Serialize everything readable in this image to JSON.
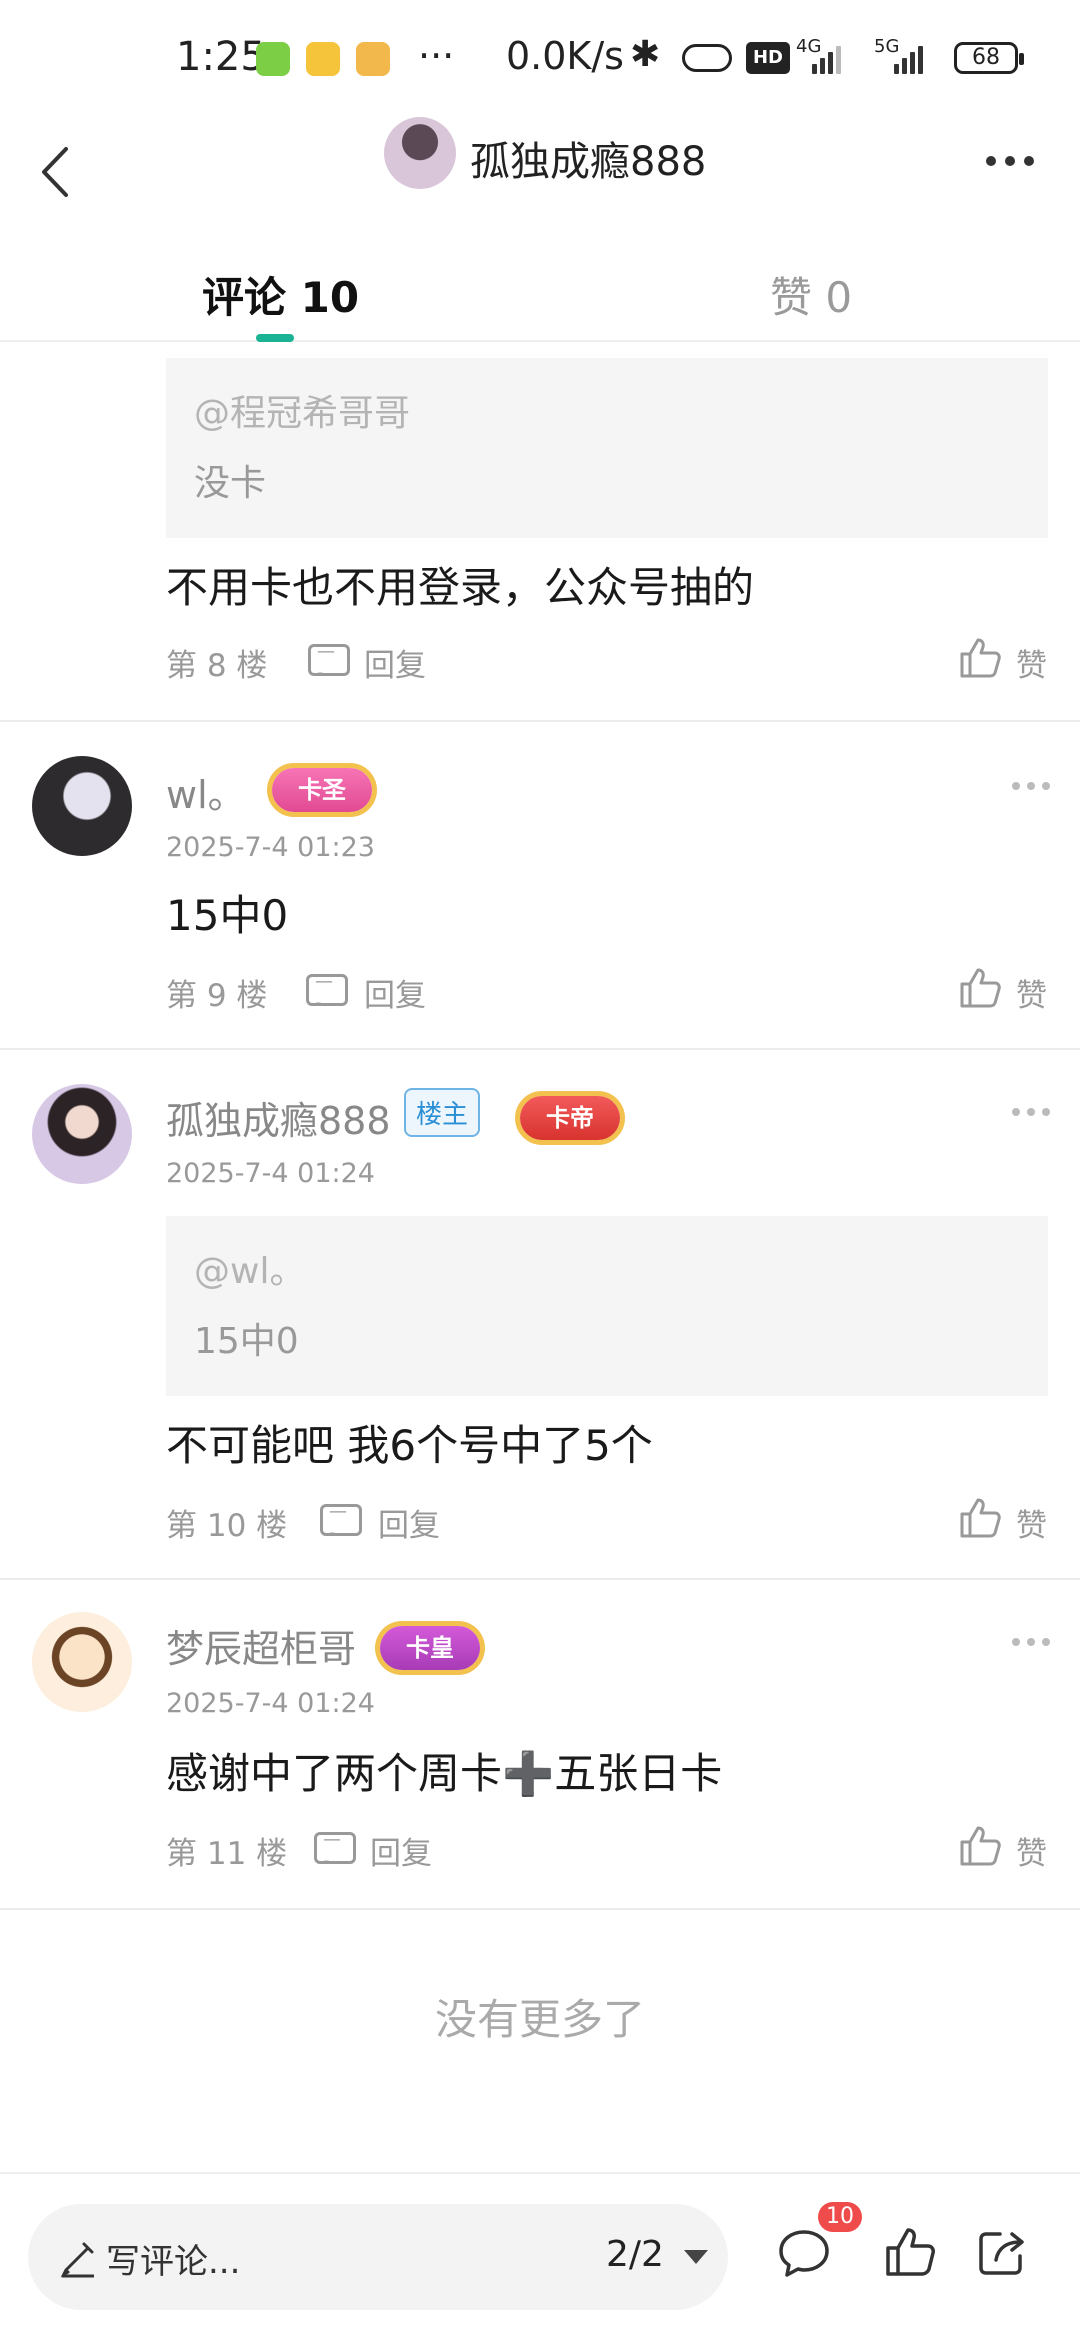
{
  "status_bar": {
    "time": "1:25",
    "more": "···",
    "net_speed": "0.0K/s",
    "network_1": "4G",
    "network_2": "5G",
    "battery": "68"
  },
  "header": {
    "title": "孤独成瘾888"
  },
  "tabs": [
    {
      "label": "评论 10"
    },
    {
      "label": "赞 0"
    }
  ],
  "comments": [
    {
      "quote_user": "@程冠希哥哥",
      "quote_text": "没卡",
      "content": "不用卡也不用登录，公众号抽的",
      "floor": "第 8 楼",
      "reply": "回复",
      "like": "赞"
    },
    {
      "username": "wl。",
      "rank": "卡圣",
      "date": "2025-7-4 01:23",
      "content": "15中0",
      "floor": "第 9 楼",
      "reply": "回复",
      "like": "赞"
    },
    {
      "username": "孤独成瘾888",
      "owner_badge": "楼主",
      "rank": "卡帝",
      "date": "2025-7-4 01:24",
      "quote_user": "@wl。",
      "quote_text": "15中0",
      "content": "不可能吧 我6个号中了5个",
      "floor": "第 10 楼",
      "reply": "回复",
      "like": "赞"
    },
    {
      "username": "梦辰超柜哥",
      "rank": "卡皇",
      "date": "2025-7-4 01:24",
      "content": "感谢中了两个周卡➕五张日卡",
      "floor": "第 11 楼",
      "reply": "回复",
      "like": "赞"
    }
  ],
  "footer_text": "没有更多了",
  "bottom_bar": {
    "placeholder": "写评论...",
    "page": "2/2",
    "comment_count": "10"
  },
  "colors": {
    "accent": "#1ab394",
    "badge_red": "#f04b4b"
  }
}
